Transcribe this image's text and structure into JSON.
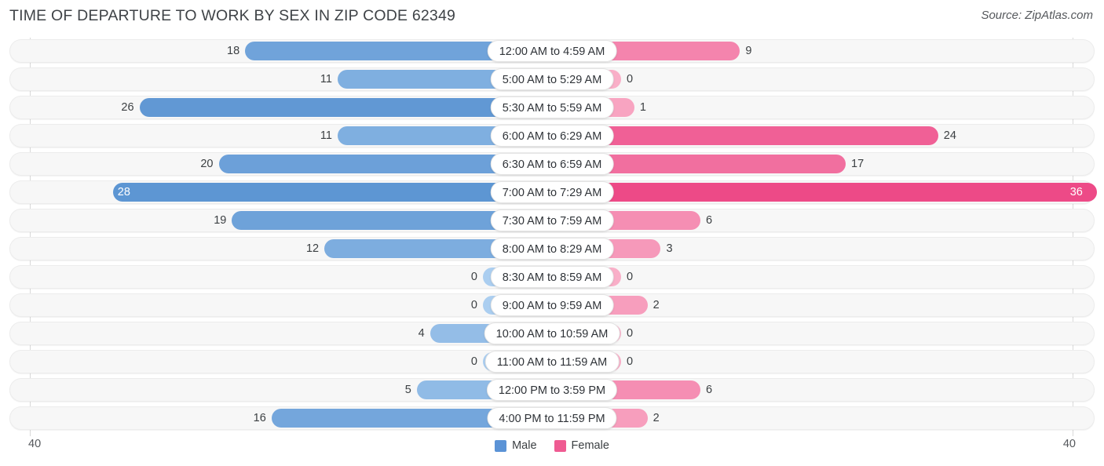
{
  "header": {
    "title": "TIME OF DEPARTURE TO WORK BY SEX IN ZIP CODE 62349",
    "source": "Source: ZipAtlas.com"
  },
  "legend": {
    "male_label": "Male",
    "female_label": "Female",
    "male_color": "#5b93d6",
    "female_color": "#ef5b92"
  },
  "axis": {
    "left_tick": "40",
    "right_tick": "40"
  },
  "chart_data": {
    "type": "bar",
    "title": "TIME OF DEPARTURE TO WORK BY SEX IN ZIP CODE 62349",
    "orientation": "horizontal-diverging",
    "xlabel": "",
    "ylabel": "",
    "xlim": [
      40,
      40
    ],
    "grid": false,
    "legend_position": "bottom-center",
    "categories": [
      "12:00 AM to 4:59 AM",
      "5:00 AM to 5:29 AM",
      "5:30 AM to 5:59 AM",
      "6:00 AM to 6:29 AM",
      "6:30 AM to 6:59 AM",
      "7:00 AM to 7:29 AM",
      "7:30 AM to 7:59 AM",
      "8:00 AM to 8:29 AM",
      "8:30 AM to 8:59 AM",
      "9:00 AM to 9:59 AM",
      "10:00 AM to 10:59 AM",
      "11:00 AM to 11:59 AM",
      "12:00 PM to 3:59 PM",
      "4:00 PM to 11:59 PM"
    ],
    "series": [
      {
        "name": "Male",
        "color": "#5b93d6",
        "values": [
          18,
          11,
          26,
          11,
          20,
          28,
          19,
          12,
          0,
          0,
          4,
          0,
          5,
          16
        ]
      },
      {
        "name": "Female",
        "color": "#ef5b92",
        "values": [
          9,
          0,
          1,
          24,
          17,
          36,
          6,
          3,
          0,
          2,
          0,
          0,
          6,
          2
        ]
      }
    ]
  }
}
